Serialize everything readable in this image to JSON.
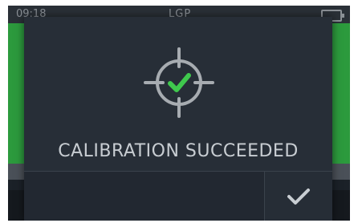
{
  "status_bar": {
    "time": "09:18",
    "title": "LGP",
    "battery_icon": "battery-icon"
  },
  "dialog": {
    "icon": "target-check-icon",
    "message": "CALIBRATION SUCCEEDED",
    "confirm_icon": "check-icon"
  },
  "colors": {
    "accent_green": "#2c9a3d",
    "check_green": "#3fc84d",
    "dialog_bg": "#272e37",
    "text": "#c8cdd2"
  }
}
